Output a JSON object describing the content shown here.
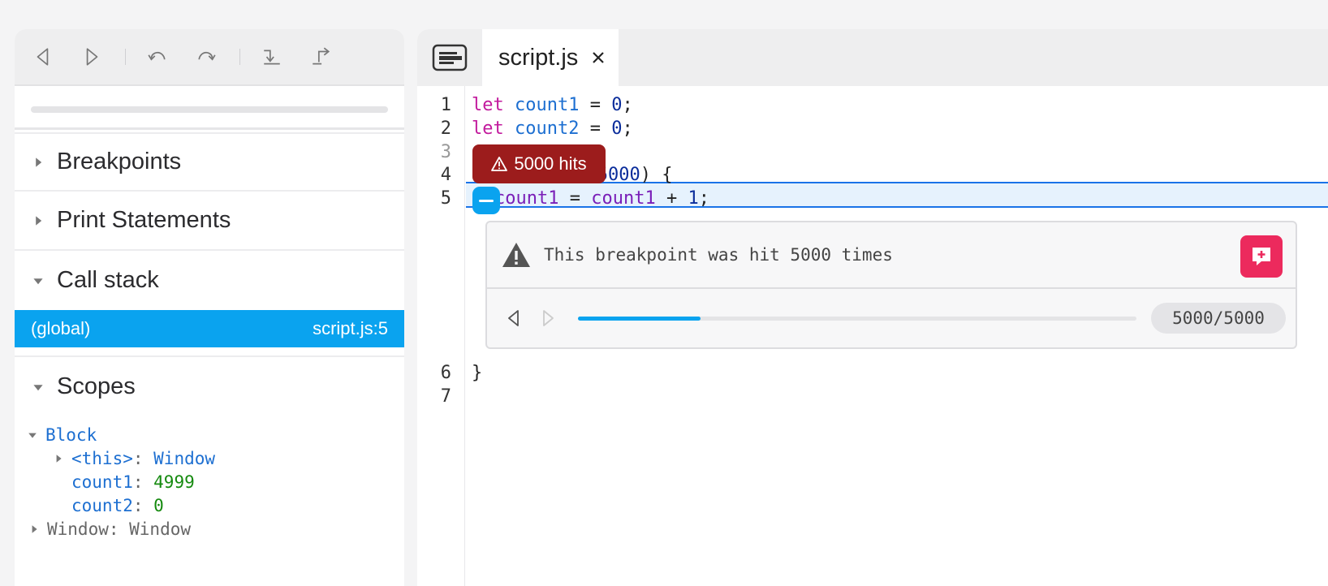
{
  "toolbar": {
    "buttons": [
      {
        "icon": "rewind-icon"
      },
      {
        "icon": "play-icon"
      },
      {
        "icon": "undo-icon"
      },
      {
        "icon": "redo-icon"
      },
      {
        "icon": "step-into-icon"
      },
      {
        "icon": "step-out-icon"
      }
    ]
  },
  "sidebar": {
    "sections": [
      {
        "label": "Breakpoints",
        "expanded": false
      },
      {
        "label": "Print Statements",
        "expanded": false
      },
      {
        "label": "Call stack",
        "expanded": true
      },
      {
        "label": "Scopes",
        "expanded": true
      }
    ],
    "call_stack": {
      "frame": "(global)",
      "location": "script.js:5"
    },
    "scopes": {
      "block_label": "Block",
      "this_key": "<this>",
      "this_value": "Window",
      "count1_key": "count1",
      "count1_value": "4999",
      "count2_key": "count2",
      "count2_value": "0",
      "window_label": "Window: Window"
    }
  },
  "editor": {
    "tab_title": "script.js",
    "line_numbers": [
      "1",
      "2",
      "3",
      "4",
      "5",
      "6",
      "7"
    ],
    "code": {
      "l1": {
        "kw": "let",
        "var": "count1",
        "op": " = ",
        "num": "0",
        "end": ";"
      },
      "l2": {
        "kw": "let",
        "var": "count2",
        "op": " = ",
        "num": "0",
        "end": ";"
      },
      "l4": {
        "tail_op": " < ",
        "num": "5000",
        "end": ") {"
      },
      "l5": {
        "var": "count1",
        "op": " = ",
        "var2": "count1",
        "plus": " + ",
        "num": "1",
        "end": ";"
      },
      "l6": "}"
    },
    "hits_badge": "5000 hits",
    "breakpoint_panel": {
      "message": "This breakpoint was hit 5000 times",
      "counter": "5000/5000",
      "progress": 0.22
    }
  },
  "colors": {
    "accent": "#0aa3ef",
    "hits_badge": "#9c1c1c",
    "add_button": "#ec2a5d",
    "highlight_border": "#1a73e8"
  }
}
